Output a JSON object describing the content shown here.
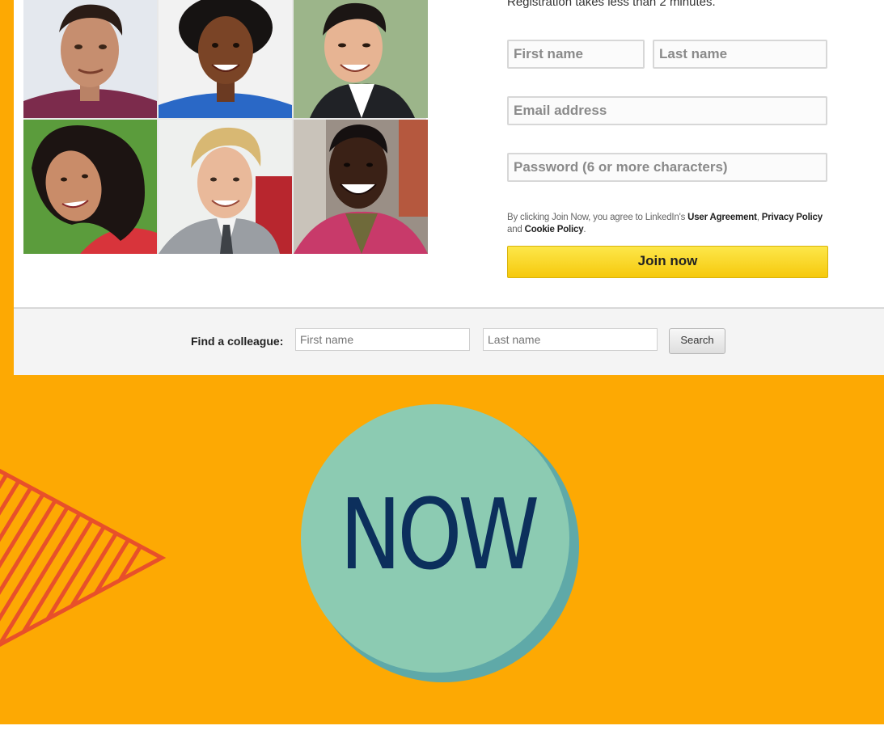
{
  "registration": {
    "note": "Registration takes less than 2 minutes.",
    "first_name_placeholder": "First name",
    "last_name_placeholder": "Last name",
    "email_placeholder": "Email address",
    "password_placeholder": "Password (6 or more characters)",
    "terms_prefix": "By clicking Join Now, you agree to LinkedIn's",
    "user_agreement": "User Agreement",
    "privacy_policy": "Privacy Policy",
    "terms_and": "and",
    "cookie_policy": "Cookie Policy",
    "join_button": "Join now"
  },
  "colleague_search": {
    "label": "Find a colleague:",
    "first_name_placeholder": "First name",
    "last_name_placeholder": "Last name",
    "search_button": "Search"
  },
  "graphic": {
    "headline": "NOW"
  },
  "colors": {
    "background": "#FDA903",
    "join_button": "#F6C90D",
    "circle": "#8CCBB2",
    "circle_shadow": "#5FA9A8",
    "headline": "#0C2F5C",
    "stripes": "#E8502A"
  },
  "photos": [
    {
      "name": "photo-man-1"
    },
    {
      "name": "photo-woman-1"
    },
    {
      "name": "photo-man-2"
    },
    {
      "name": "photo-woman-2"
    },
    {
      "name": "photo-man-3"
    },
    {
      "name": "photo-man-4"
    }
  ]
}
